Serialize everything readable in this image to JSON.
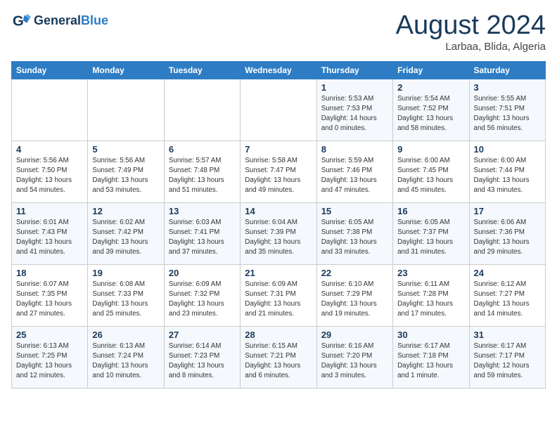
{
  "logo": {
    "line1": "General",
    "line2": "Blue"
  },
  "title": "August 2024",
  "location": "Larbaa, Blida, Algeria",
  "days_of_week": [
    "Sunday",
    "Monday",
    "Tuesday",
    "Wednesday",
    "Thursday",
    "Friday",
    "Saturday"
  ],
  "weeks": [
    [
      {
        "num": "",
        "info": ""
      },
      {
        "num": "",
        "info": ""
      },
      {
        "num": "",
        "info": ""
      },
      {
        "num": "",
        "info": ""
      },
      {
        "num": "1",
        "info": "Sunrise: 5:53 AM\nSunset: 7:53 PM\nDaylight: 14 hours\nand 0 minutes."
      },
      {
        "num": "2",
        "info": "Sunrise: 5:54 AM\nSunset: 7:52 PM\nDaylight: 13 hours\nand 58 minutes."
      },
      {
        "num": "3",
        "info": "Sunrise: 5:55 AM\nSunset: 7:51 PM\nDaylight: 13 hours\nand 56 minutes."
      }
    ],
    [
      {
        "num": "4",
        "info": "Sunrise: 5:56 AM\nSunset: 7:50 PM\nDaylight: 13 hours\nand 54 minutes."
      },
      {
        "num": "5",
        "info": "Sunrise: 5:56 AM\nSunset: 7:49 PM\nDaylight: 13 hours\nand 53 minutes."
      },
      {
        "num": "6",
        "info": "Sunrise: 5:57 AM\nSunset: 7:48 PM\nDaylight: 13 hours\nand 51 minutes."
      },
      {
        "num": "7",
        "info": "Sunrise: 5:58 AM\nSunset: 7:47 PM\nDaylight: 13 hours\nand 49 minutes."
      },
      {
        "num": "8",
        "info": "Sunrise: 5:59 AM\nSunset: 7:46 PM\nDaylight: 13 hours\nand 47 minutes."
      },
      {
        "num": "9",
        "info": "Sunrise: 6:00 AM\nSunset: 7:45 PM\nDaylight: 13 hours\nand 45 minutes."
      },
      {
        "num": "10",
        "info": "Sunrise: 6:00 AM\nSunset: 7:44 PM\nDaylight: 13 hours\nand 43 minutes."
      }
    ],
    [
      {
        "num": "11",
        "info": "Sunrise: 6:01 AM\nSunset: 7:43 PM\nDaylight: 13 hours\nand 41 minutes."
      },
      {
        "num": "12",
        "info": "Sunrise: 6:02 AM\nSunset: 7:42 PM\nDaylight: 13 hours\nand 39 minutes."
      },
      {
        "num": "13",
        "info": "Sunrise: 6:03 AM\nSunset: 7:41 PM\nDaylight: 13 hours\nand 37 minutes."
      },
      {
        "num": "14",
        "info": "Sunrise: 6:04 AM\nSunset: 7:39 PM\nDaylight: 13 hours\nand 35 minutes."
      },
      {
        "num": "15",
        "info": "Sunrise: 6:05 AM\nSunset: 7:38 PM\nDaylight: 13 hours\nand 33 minutes."
      },
      {
        "num": "16",
        "info": "Sunrise: 6:05 AM\nSunset: 7:37 PM\nDaylight: 13 hours\nand 31 minutes."
      },
      {
        "num": "17",
        "info": "Sunrise: 6:06 AM\nSunset: 7:36 PM\nDaylight: 13 hours\nand 29 minutes."
      }
    ],
    [
      {
        "num": "18",
        "info": "Sunrise: 6:07 AM\nSunset: 7:35 PM\nDaylight: 13 hours\nand 27 minutes."
      },
      {
        "num": "19",
        "info": "Sunrise: 6:08 AM\nSunset: 7:33 PM\nDaylight: 13 hours\nand 25 minutes."
      },
      {
        "num": "20",
        "info": "Sunrise: 6:09 AM\nSunset: 7:32 PM\nDaylight: 13 hours\nand 23 minutes."
      },
      {
        "num": "21",
        "info": "Sunrise: 6:09 AM\nSunset: 7:31 PM\nDaylight: 13 hours\nand 21 minutes."
      },
      {
        "num": "22",
        "info": "Sunrise: 6:10 AM\nSunset: 7:29 PM\nDaylight: 13 hours\nand 19 minutes."
      },
      {
        "num": "23",
        "info": "Sunrise: 6:11 AM\nSunset: 7:28 PM\nDaylight: 13 hours\nand 17 minutes."
      },
      {
        "num": "24",
        "info": "Sunrise: 6:12 AM\nSunset: 7:27 PM\nDaylight: 13 hours\nand 14 minutes."
      }
    ],
    [
      {
        "num": "25",
        "info": "Sunrise: 6:13 AM\nSunset: 7:25 PM\nDaylight: 13 hours\nand 12 minutes."
      },
      {
        "num": "26",
        "info": "Sunrise: 6:13 AM\nSunset: 7:24 PM\nDaylight: 13 hours\nand 10 minutes."
      },
      {
        "num": "27",
        "info": "Sunrise: 6:14 AM\nSunset: 7:23 PM\nDaylight: 13 hours\nand 8 minutes."
      },
      {
        "num": "28",
        "info": "Sunrise: 6:15 AM\nSunset: 7:21 PM\nDaylight: 13 hours\nand 6 minutes."
      },
      {
        "num": "29",
        "info": "Sunrise: 6:16 AM\nSunset: 7:20 PM\nDaylight: 13 hours\nand 3 minutes."
      },
      {
        "num": "30",
        "info": "Sunrise: 6:17 AM\nSunset: 7:18 PM\nDaylight: 13 hours\nand 1 minute."
      },
      {
        "num": "31",
        "info": "Sunrise: 6:17 AM\nSunset: 7:17 PM\nDaylight: 12 hours\nand 59 minutes."
      }
    ]
  ]
}
